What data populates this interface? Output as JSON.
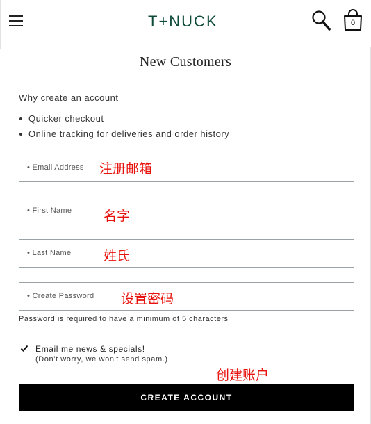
{
  "header": {
    "logo": "T+NUCK",
    "bag_count": "0"
  },
  "page_title": "New Customers",
  "why": {
    "heading": "Why create an account",
    "bullets": [
      "Quicker checkout",
      "Online tracking for deliveries and order history"
    ]
  },
  "form": {
    "email_label": "• Email Address",
    "first_name_label": "• First Name",
    "last_name_label": "• Last Name",
    "password_label": "• Create Password",
    "password_hint": "Password is required to have a minimum of 5 characters",
    "newsletter_label": "Email me news & specials!",
    "newsletter_sub": "(Don't worry, we won't send spam.)",
    "newsletter_checked": true,
    "submit_label": "CREATE ACCOUNT"
  },
  "annotations": {
    "email": "注册邮箱",
    "first_name": "名字",
    "last_name": "姓氏",
    "password": "设置密码",
    "create": "创建账户"
  },
  "colors": {
    "annotation": "#e8120c",
    "logo": "#0e4a3a",
    "button_bg": "#000000"
  }
}
